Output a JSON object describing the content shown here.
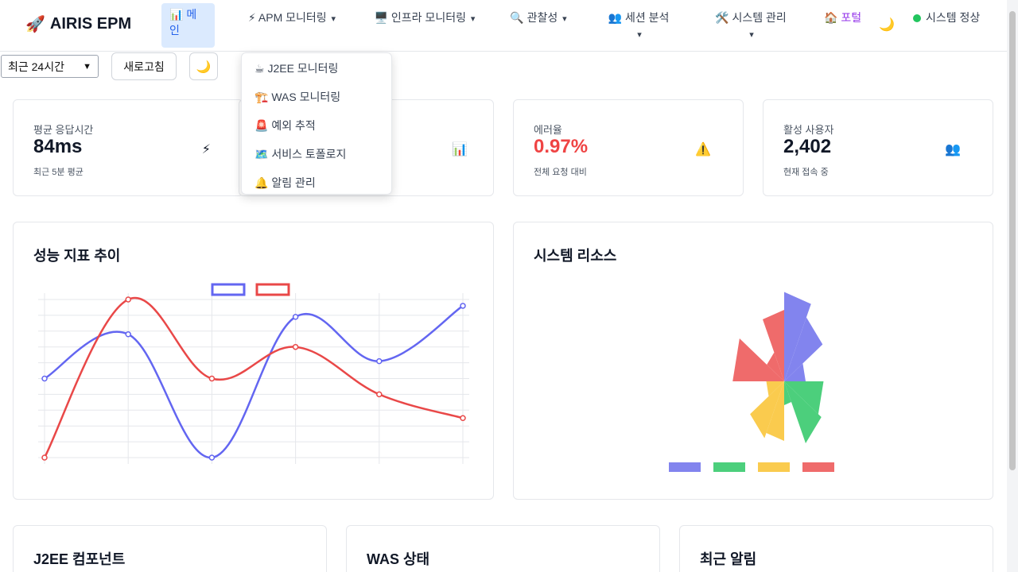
{
  "header": {
    "logo_icon": "🚀",
    "logo_text": "AIRIS EPM",
    "nav": {
      "main": {
        "icon": "📊",
        "label": "메인"
      },
      "apm": {
        "icon": "⚡",
        "label": "APM 모니터링"
      },
      "infra": {
        "icon": "🖥️",
        "label": "인프라 모니터링"
      },
      "observability": {
        "icon": "🔍",
        "label": "관찰성"
      },
      "session": {
        "icon": "👥",
        "label": "세션 분석"
      },
      "system": {
        "icon": "🛠️",
        "label": "시스템 관리"
      },
      "portal": {
        "icon": "🏠",
        "label": "포털"
      }
    },
    "caret": "▾",
    "theme_icon": "🌙",
    "status_text": "시스템 정상",
    "status_color": "#22c55e"
  },
  "toolbar": {
    "range_value": "최근 24시간",
    "refresh_label": "새로고침",
    "theme_icon": "🌙"
  },
  "apm_dropdown": [
    {
      "icon": "☕",
      "label": "J2EE 모니터링"
    },
    {
      "icon": "🏗️",
      "label": "WAS 모니터링"
    },
    {
      "icon": "🚨",
      "label": "예외 추적"
    },
    {
      "icon": "🗺️",
      "label": "서비스 토폴로지"
    },
    {
      "icon": "🔔",
      "label": "알림 관리"
    }
  ],
  "kpis": [
    {
      "label": "평균 응답시간",
      "value": "84ms",
      "sub": "최근 5분 평균",
      "icon": "⚡"
    },
    {
      "label": "",
      "value": "",
      "sub": "",
      "icon": "📊"
    },
    {
      "label": "에러율",
      "value": "0.97%",
      "sub": "전체 요청 대비",
      "icon": "⚠️"
    },
    {
      "label": "활성 사용자",
      "value": "2,402",
      "sub": "현재 접속 중",
      "icon": "👥"
    }
  ],
  "panels": {
    "performance_title": "성능 지표 추이",
    "resources_title": "시스템 리소스",
    "j2ee_title": "J2EE 컴포넌트",
    "was_title": "WAS 상태",
    "alerts_title": "최근 알림"
  },
  "chart_data": [
    {
      "type": "line",
      "title": "",
      "x": [
        0,
        1,
        2,
        3,
        4,
        5
      ],
      "series": [
        {
          "color": "#6366f1",
          "values": [
            50,
            78,
            0,
            89,
            61,
            96
          ]
        },
        {
          "color": "#e94848",
          "values": [
            0,
            100,
            50,
            70,
            40,
            25
          ]
        }
      ],
      "ylim": [
        0,
        100
      ],
      "grid": true,
      "legend": "top-center"
    },
    {
      "type": "polarArea",
      "title": "",
      "series": [
        {
          "color": "#8284ee",
          "values": [
            0.75,
            0.62,
            0.3
          ]
        },
        {
          "color": "#4ccf7c",
          "values": [
            0.55,
            0.6,
            0.2
          ]
        },
        {
          "color": "#facb4e",
          "values": [
            0.5,
            0.55,
            0.25
          ]
        },
        {
          "color": "#ef6b6b",
          "values": [
            0.72,
            0.28,
            0.6
          ]
        }
      ],
      "legend": "bottom-center"
    }
  ]
}
